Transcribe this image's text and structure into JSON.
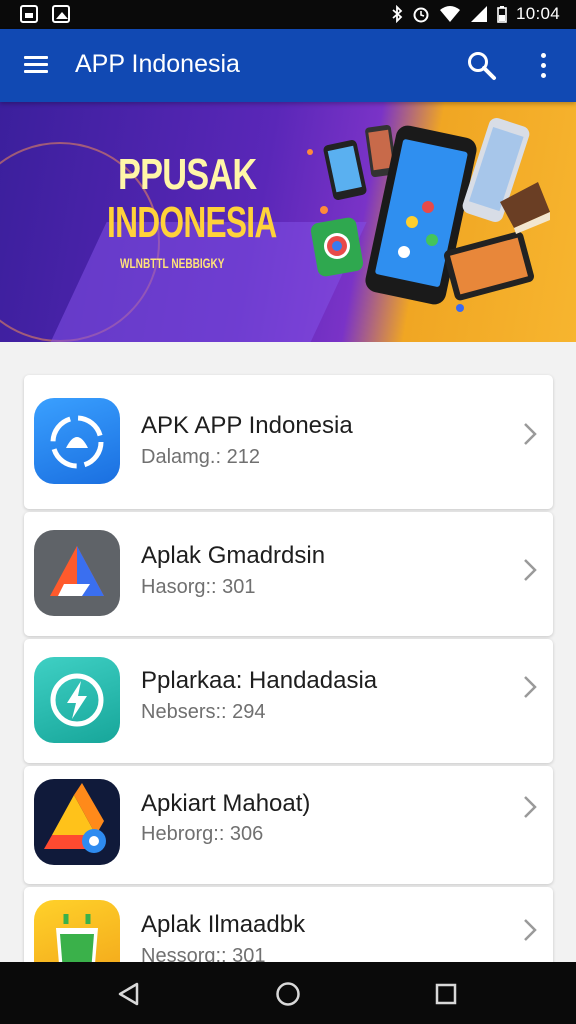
{
  "status_bar": {
    "time": "10:04",
    "icons": [
      "gallery-icon",
      "photo-icon",
      "bluetooth-icon",
      "alarm-icon",
      "wifi-icon",
      "signal-icon",
      "battery-icon"
    ]
  },
  "app_bar": {
    "title": "APP Indonesia",
    "icons": [
      "menu-icon",
      "search-icon",
      "more-vert-icon"
    ]
  },
  "banner": {
    "line1": "PPUSAK",
    "line2": "INDONESIA",
    "tagline": "WLNBTTL NEBBIGKY"
  },
  "apps": [
    {
      "name": "APK APP Indonesia",
      "meta": "Dalamg.: 212",
      "icon": "blue-shield-icon"
    },
    {
      "name": "Aplak Gmadrdsin",
      "meta": "Hasorg:: 301",
      "icon": "triangle-logo-icon"
    },
    {
      "name": "Pplarkaa: Handadasia",
      "meta": "Nebsers:: 294",
      "icon": "bolt-icon"
    },
    {
      "name": "Apkiart Mahoat)",
      "meta": "Hebrorg:: 306",
      "icon": "drive-logo-icon"
    },
    {
      "name": "Aplak Ilmaadbk",
      "meta": "Nessorg:: 301",
      "icon": "green-bag-icon"
    }
  ],
  "colors": {
    "app_bar": "#1149b3",
    "banner_purple": "#5a27b8",
    "banner_orange": "#f7b52f",
    "nav_bar": "#0a0a0a"
  },
  "nav": [
    "back-icon",
    "home-icon",
    "recents-icon"
  ]
}
